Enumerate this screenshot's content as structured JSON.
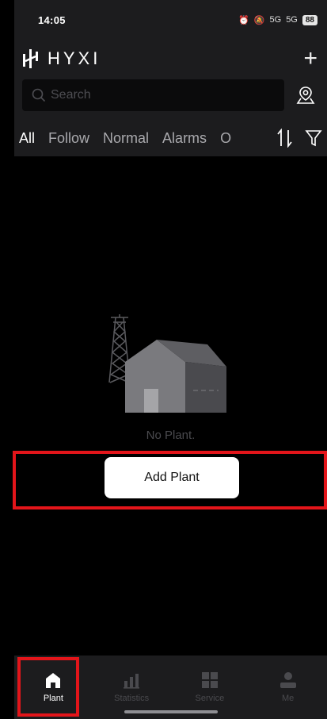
{
  "status_bar": {
    "time": "14:05",
    "signal_1": "5G",
    "signal_2": "5G",
    "battery": "88"
  },
  "header": {
    "brand": "HYXI",
    "add_icon": "plus-icon"
  },
  "search": {
    "placeholder": "Search",
    "map_icon": "map-pin-icon"
  },
  "tabs": {
    "items": [
      "All",
      "Follow",
      "Normal",
      "Alarms",
      "Of"
    ],
    "active": "All",
    "sort_icon": "sort-icon",
    "filter_icon": "filter-icon"
  },
  "empty_state": {
    "illustration": "plant-house-icon",
    "message": "No Plant."
  },
  "actions": {
    "add_plant_label": "Add Plant"
  },
  "bottom_nav": [
    {
      "label": "Plant",
      "icon": "home-icon",
      "active": true
    },
    {
      "label": "Statistics",
      "icon": "bar-chart-icon",
      "active": false
    },
    {
      "label": "Service",
      "icon": "grid-icon",
      "active": false
    },
    {
      "label": "Me",
      "icon": "person-icon",
      "active": false
    }
  ],
  "colors": {
    "highlight": "#e3151a",
    "bar_bg": "#1c1c1e",
    "screen_bg": "#000000"
  }
}
